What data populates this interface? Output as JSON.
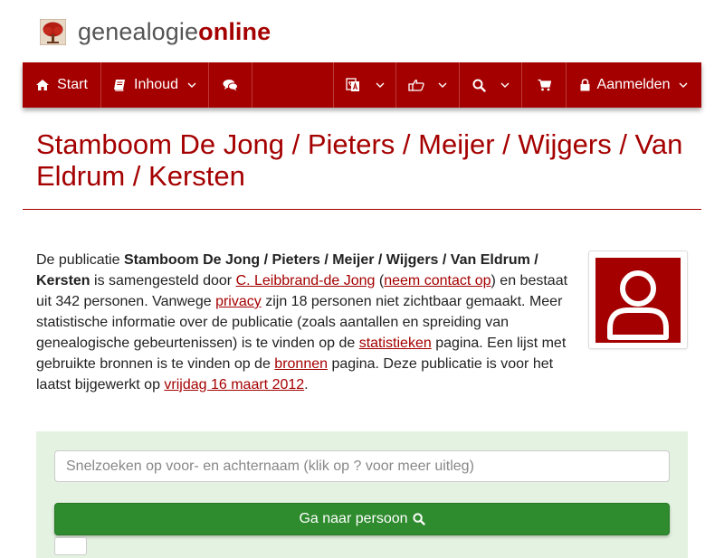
{
  "brand": {
    "part1": "genealogie",
    "part2": "online",
    "accent": "#a50000"
  },
  "nav": {
    "start": "Start",
    "inhoud": "Inhoud",
    "chat_icon": "comments-icon",
    "language_icon": "translate-icon",
    "share_icon": "share-icon",
    "search_icon": "search-icon",
    "cart_icon": "cart-icon",
    "login": "Aanmelden"
  },
  "page": {
    "title": "Stamboom De Jong / Pieters / Meijer / Wijgers / Van Eldrum / Kersten"
  },
  "intro": {
    "t1": "De publicatie ",
    "pub": "Stamboom De Jong / Pieters / Meijer / Wijgers / Van Eldrum / Kersten",
    "t2": " is samengesteld door ",
    "author": "C. Leibbrand-de Jong",
    "t3": " (",
    "contact": "neem contact op",
    "t4": ") en bestaat uit 342 personen. Vanwege ",
    "privacy": "privacy",
    "t5": " zijn 18 personen niet zichtbaar gemaakt. Meer statistische informatie over de publicatie (zoals aantallen en spreiding van genealogische gebeurtenissen) is te vinden op de ",
    "stats": "statistieken",
    "t6": " pagina. Een lijst met gebruikte bronnen is te vinden op de ",
    "sources": "bronnen",
    "t7": " pagina. Deze publicatie is voor het laatst bijgewerkt op ",
    "date": "vrijdag 16 maart 2012",
    "t8": "."
  },
  "search": {
    "placeholder": "Snelzoeken op voor- en achternaam (klik op ? voor meer uitleg)",
    "button": "Ga naar persoon",
    "button_color": "#2e8b2e",
    "panel_color": "#e4f2e1"
  }
}
